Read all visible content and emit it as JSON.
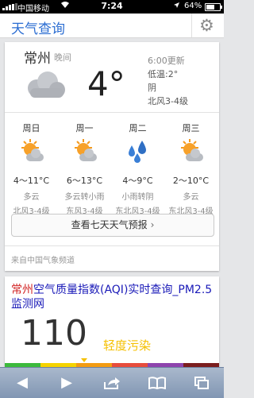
{
  "status": {
    "carrier": "中国移动",
    "time": "7:24",
    "battery": "64%",
    "battery_level": 0.64
  },
  "header": {
    "title": "天气查询",
    "settings_icon": "gear-icon"
  },
  "current": {
    "city": "常州",
    "period": "晚间",
    "temperature": "4°",
    "updated": "6:00更新",
    "low": "低温:2°",
    "condition": "阴",
    "wind": "北风3-4级",
    "icon": "cloud-icon"
  },
  "forecast": [
    {
      "day": "周日",
      "icon": "sun-cloud-icon",
      "range": "4～11°C",
      "condition": "多云",
      "wind": "北风3-4级"
    },
    {
      "day": "周一",
      "icon": "sun-cloud-icon",
      "range": "6～13°C",
      "condition": "多云转小雨",
      "wind": "东风3-4级"
    },
    {
      "day": "周二",
      "icon": "rain-drops-icon",
      "range": "4～9°C",
      "condition": "小雨转阴",
      "wind": "东北风3-4级"
    },
    {
      "day": "周三",
      "icon": "sun-cloud-icon",
      "range": "2～10°C",
      "condition": "多云",
      "wind": "东北风3-4级"
    }
  ],
  "seven_day_button": "查看七天天气预报",
  "source": "来自中国气象频道",
  "aqi": {
    "title_keyword": "常州",
    "title_rest": "空气质量指数(AQI)实时查询_PM2.5监测网",
    "value": "110",
    "level": "轻度污染",
    "scale_colors": [
      "#3cba3c",
      "#f5d300",
      "#f39c12",
      "#e74c3c",
      "#8e44ad",
      "#7b1e1e"
    ],
    "level_color": "#f5c000"
  },
  "toolbar": {
    "back": "◀",
    "forward": "▶"
  }
}
